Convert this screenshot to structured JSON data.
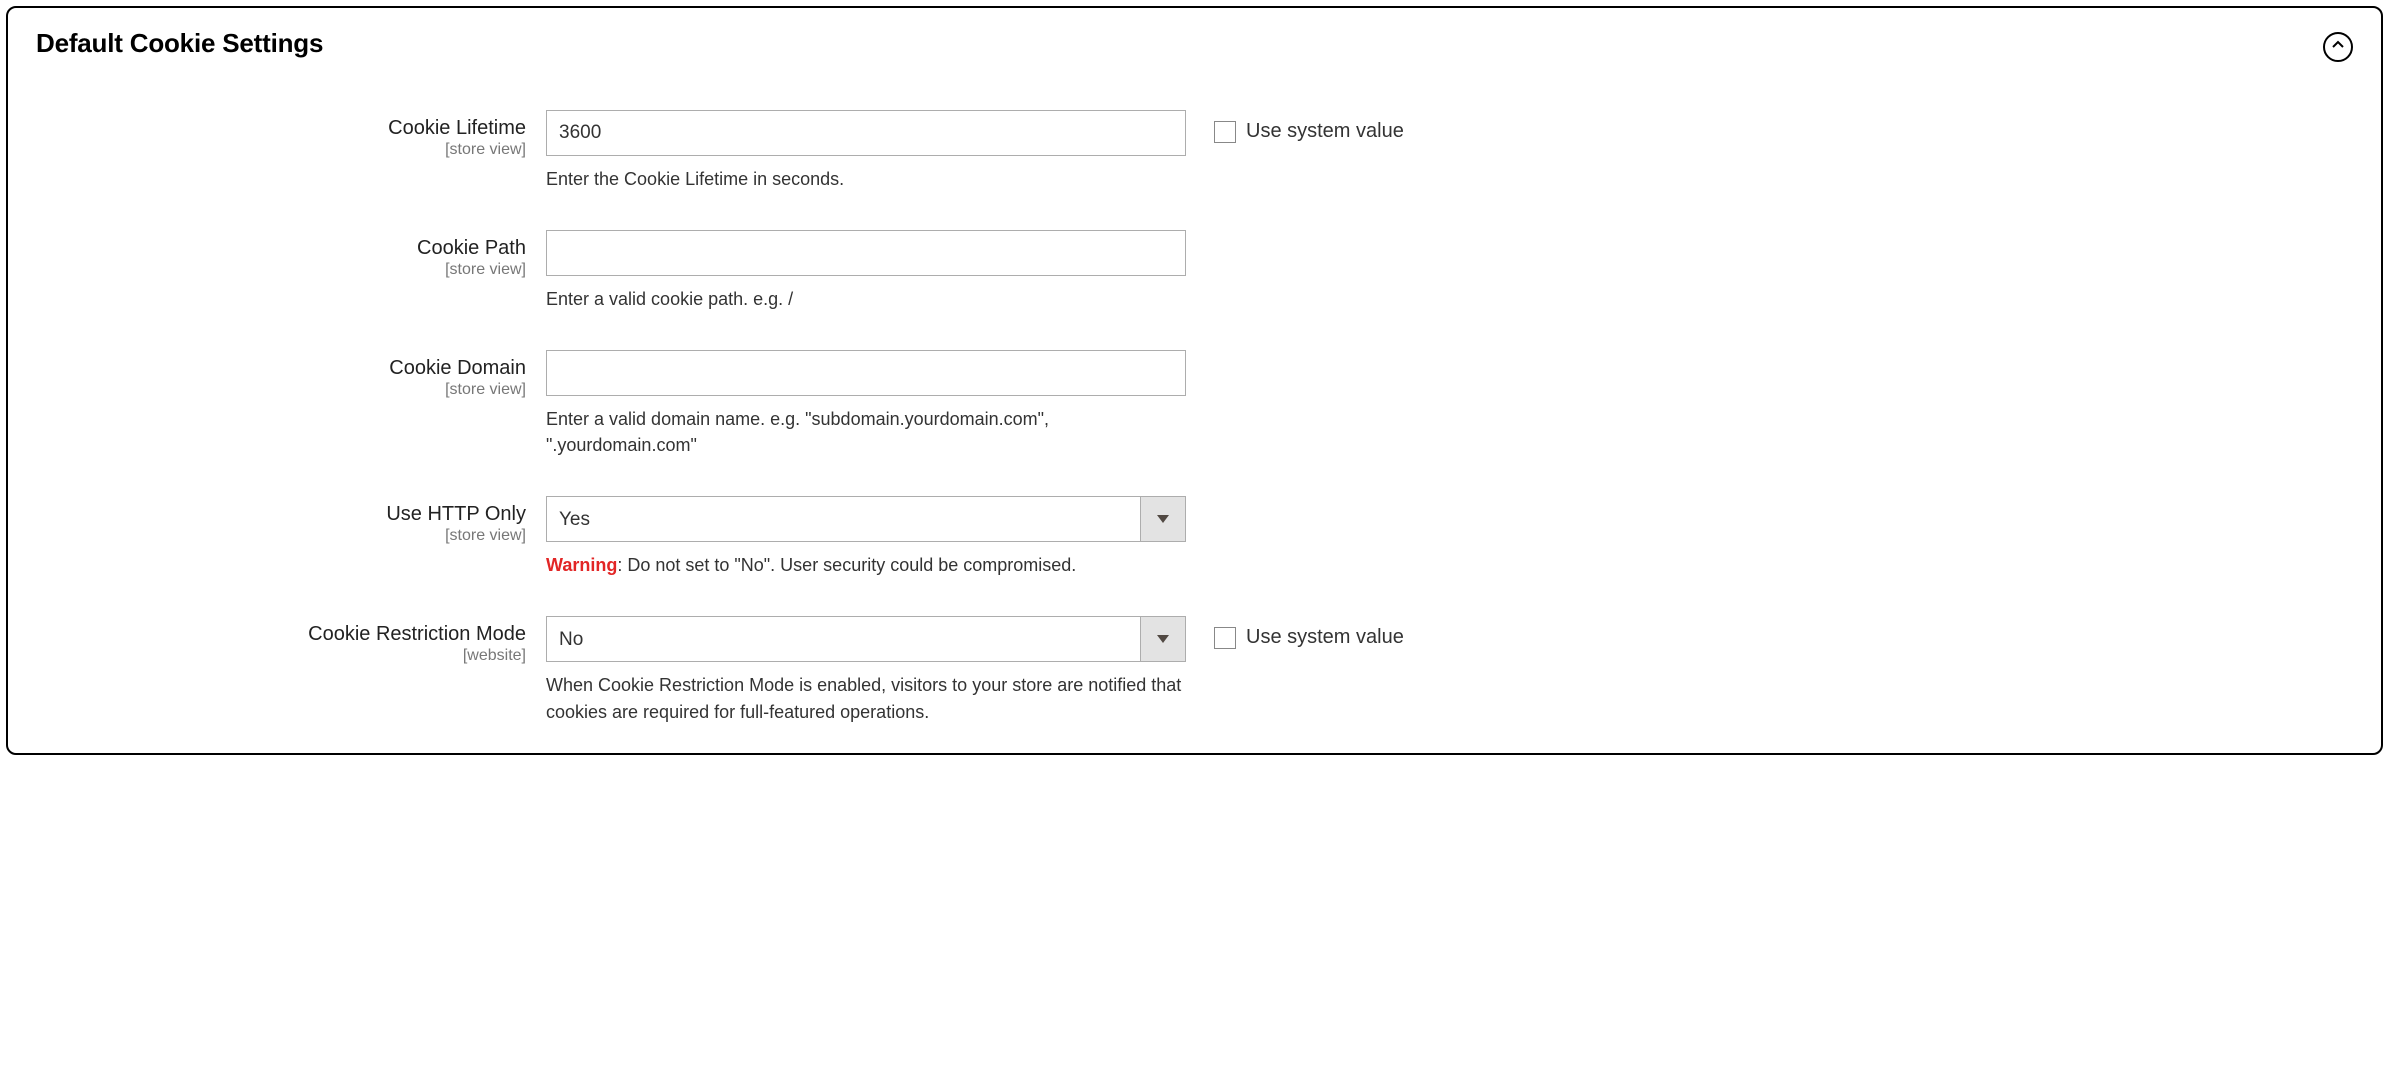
{
  "panel": {
    "title": "Default Cookie Settings"
  },
  "common": {
    "scope_store_view": "[store view]",
    "scope_website": "[website]",
    "use_system_value": "Use system value"
  },
  "fields": {
    "cookie_lifetime": {
      "label": "Cookie Lifetime",
      "value": "3600",
      "help": "Enter the Cookie Lifetime in seconds."
    },
    "cookie_path": {
      "label": "Cookie Path",
      "value": "",
      "help": "Enter a valid cookie path. e.g. /"
    },
    "cookie_domain": {
      "label": "Cookie Domain",
      "value": "",
      "help": "Enter a valid domain name. e.g. \"subdomain.yourdomain.com\", \".yourdomain.com\""
    },
    "use_http_only": {
      "label": "Use HTTP Only",
      "value": "Yes",
      "warning_label": "Warning",
      "warning_text": ": Do not set to \"No\". User security could be compromised."
    },
    "cookie_restriction": {
      "label": "Cookie Restriction Mode",
      "value": "No",
      "help": "When Cookie Restriction Mode is enabled, visitors to your store are notified that cookies are required for full-featured operations."
    }
  }
}
